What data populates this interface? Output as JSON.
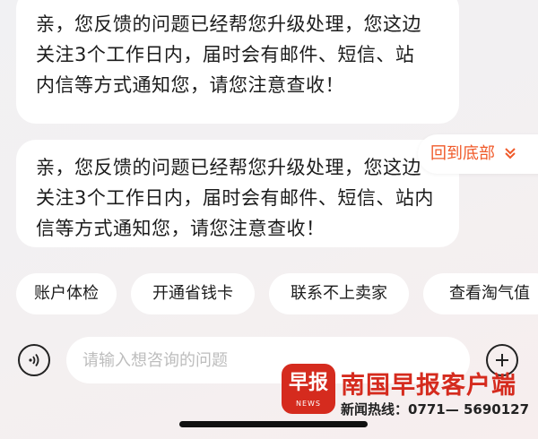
{
  "messages": [
    {
      "lines": [
        "亲，您反馈的问题已经帮您升级处理，您这边",
        "关注3个工作日内，届时会有邮件、短信、站",
        "内信等方式通知您，请您注意查收！"
      ]
    },
    {
      "lines": [
        "亲，您反馈的问题已经帮您升级处理，您这边",
        "关注3个工作日内，届时会有邮件、短信、站内",
        "信等方式通知您，请您注意查收！"
      ]
    }
  ],
  "back_to_bottom": {
    "label": "回到底部",
    "icon": "double-chevron-down-icon",
    "color": "#f05a2a"
  },
  "quick_replies": [
    "账户体检",
    "开通省钱卡",
    "联系不上卖家",
    "查看淘气值"
  ],
  "input": {
    "placeholder": "请输入想咨询的问题",
    "value": ""
  },
  "icons": {
    "voice": "voice-icon",
    "plus": "plus-icon"
  },
  "watermark": {
    "logo_text": "早报",
    "logo_subtext": "NEWS",
    "title": "南国早报客户端",
    "hotline": "新闻热线：0771— 5690127",
    "brand_color": "#d52b1e"
  }
}
